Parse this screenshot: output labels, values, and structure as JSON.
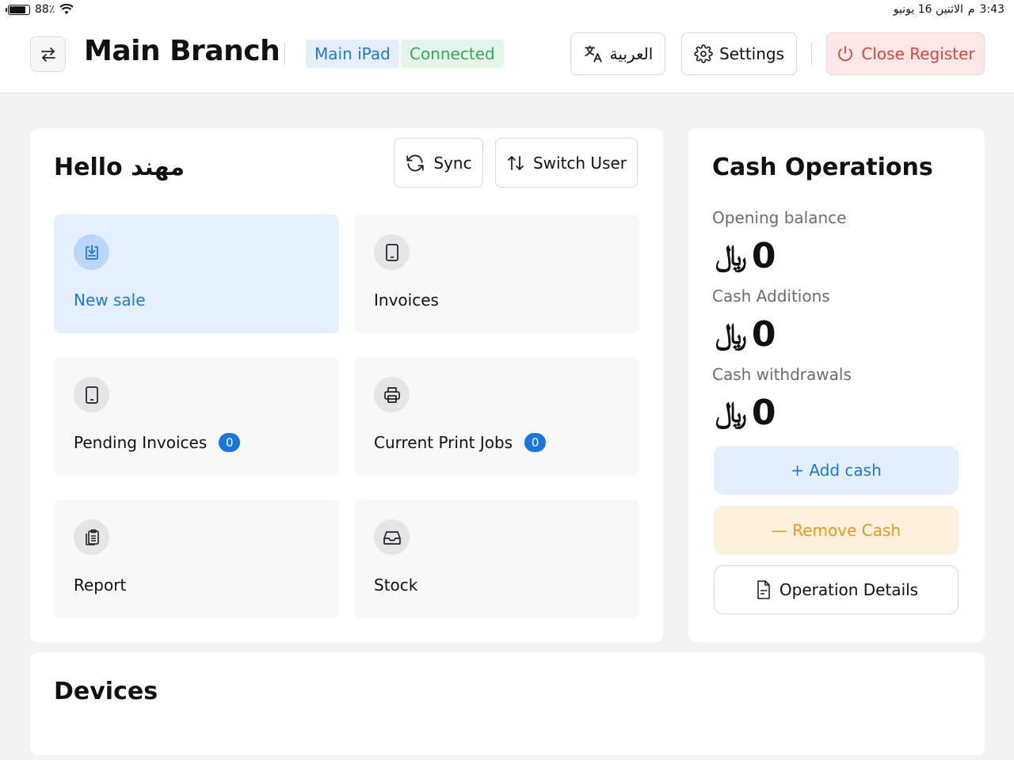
{
  "status_bar": {
    "battery": "88٪",
    "time": "3:43",
    "date": "الاثنين 16 يونيو",
    "ampm": "م"
  },
  "header": {
    "branch_title": "Main Branch",
    "device_badge": "Main iPad",
    "connection_badge": "Connected",
    "language_label": "العربية",
    "settings_label": "Settings",
    "close_register_label": "Close Register"
  },
  "main": {
    "greeting": "Hello مهند",
    "sync_label": "Sync",
    "switch_user_label": "Switch User",
    "tiles": [
      {
        "label": "New sale",
        "icon": "download-icon"
      },
      {
        "label": "Invoices",
        "icon": "tablet-icon"
      },
      {
        "label": "Pending Invoices",
        "icon": "tablet-icon",
        "count": "0"
      },
      {
        "label": "Current Print Jobs",
        "icon": "printer-icon",
        "count": "0"
      },
      {
        "label": "Report",
        "icon": "clipboard-icon"
      },
      {
        "label": "Stock",
        "icon": "inbox-icon"
      }
    ]
  },
  "cash": {
    "title": "Cash Operations",
    "currency_symbol": "﷼",
    "opening_label": "Opening balance",
    "opening_value": "0",
    "additions_label": "Cash Additions",
    "additions_value": "0",
    "withdrawals_label": "Cash withdrawals",
    "withdrawals_value": "0",
    "add_label": "+ Add cash",
    "remove_label": "— Remove Cash",
    "details_label": "Operation Details"
  },
  "devices": {
    "title": "Devices"
  },
  "colors": {
    "accent": "#1f78d6",
    "success": "#2eae5c",
    "danger": "#e0413f",
    "warning": "#e59b1c"
  }
}
